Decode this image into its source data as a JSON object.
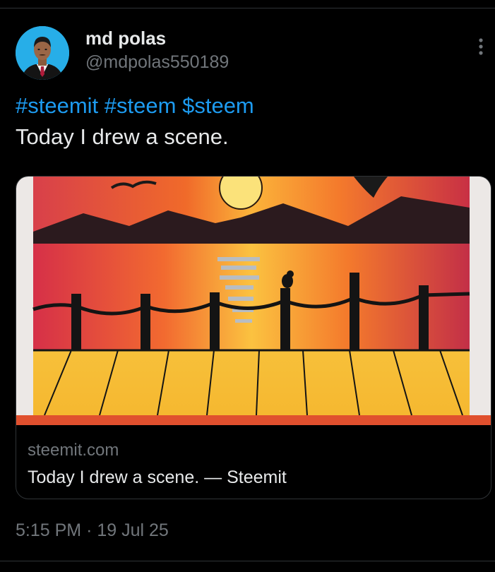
{
  "author": {
    "display_name": "md polas",
    "handle": "@mdpolas550189"
  },
  "tweet": {
    "hashtags": [
      "#steemit",
      "#steem",
      "$steem"
    ],
    "text": "Today I drew a scene."
  },
  "link_card": {
    "domain": "steemit.com",
    "title": "Today I drew a scene. — Steemit"
  },
  "meta": {
    "time": "5:15 PM",
    "separator": "·",
    "date": "19 Jul 25"
  },
  "icons": {
    "more": "more-vertical-icon",
    "avatar": "profile-photo"
  },
  "colors": {
    "background": "#000000",
    "text": "#e7e9ea",
    "muted": "#71767b",
    "link": "#1d9bf0",
    "border": "#2f3336"
  }
}
